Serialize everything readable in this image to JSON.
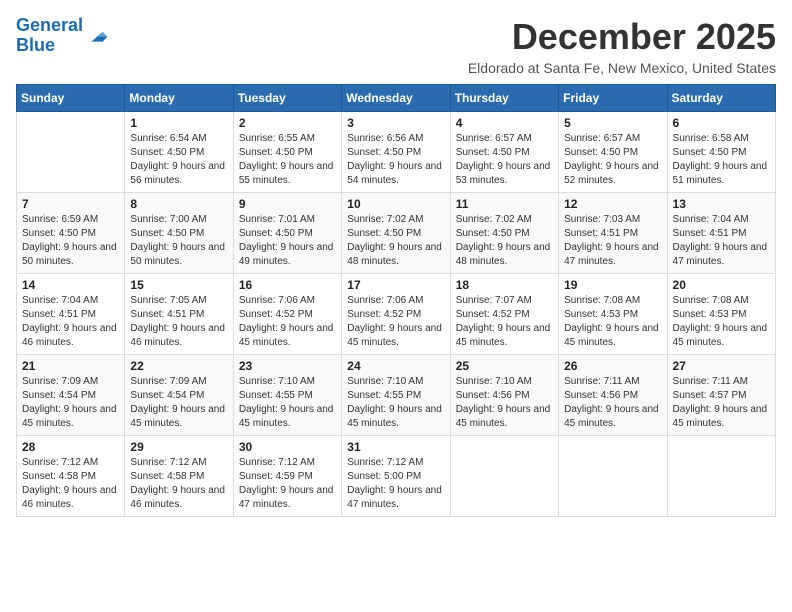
{
  "logo": {
    "text_general": "General",
    "text_blue": "Blue"
  },
  "title": "December 2025",
  "location": "Eldorado at Santa Fe, New Mexico, United States",
  "days_of_week": [
    "Sunday",
    "Monday",
    "Tuesday",
    "Wednesday",
    "Thursday",
    "Friday",
    "Saturday"
  ],
  "weeks": [
    [
      {
        "day": "",
        "sunrise": "",
        "sunset": "",
        "daylight": ""
      },
      {
        "day": "1",
        "sunrise": "Sunrise: 6:54 AM",
        "sunset": "Sunset: 4:50 PM",
        "daylight": "Daylight: 9 hours and 56 minutes."
      },
      {
        "day": "2",
        "sunrise": "Sunrise: 6:55 AM",
        "sunset": "Sunset: 4:50 PM",
        "daylight": "Daylight: 9 hours and 55 minutes."
      },
      {
        "day": "3",
        "sunrise": "Sunrise: 6:56 AM",
        "sunset": "Sunset: 4:50 PM",
        "daylight": "Daylight: 9 hours and 54 minutes."
      },
      {
        "day": "4",
        "sunrise": "Sunrise: 6:57 AM",
        "sunset": "Sunset: 4:50 PM",
        "daylight": "Daylight: 9 hours and 53 minutes."
      },
      {
        "day": "5",
        "sunrise": "Sunrise: 6:57 AM",
        "sunset": "Sunset: 4:50 PM",
        "daylight": "Daylight: 9 hours and 52 minutes."
      },
      {
        "day": "6",
        "sunrise": "Sunrise: 6:58 AM",
        "sunset": "Sunset: 4:50 PM",
        "daylight": "Daylight: 9 hours and 51 minutes."
      }
    ],
    [
      {
        "day": "7",
        "sunrise": "Sunrise: 6:59 AM",
        "sunset": "Sunset: 4:50 PM",
        "daylight": "Daylight: 9 hours and 50 minutes."
      },
      {
        "day": "8",
        "sunrise": "Sunrise: 7:00 AM",
        "sunset": "Sunset: 4:50 PM",
        "daylight": "Daylight: 9 hours and 50 minutes."
      },
      {
        "day": "9",
        "sunrise": "Sunrise: 7:01 AM",
        "sunset": "Sunset: 4:50 PM",
        "daylight": "Daylight: 9 hours and 49 minutes."
      },
      {
        "day": "10",
        "sunrise": "Sunrise: 7:02 AM",
        "sunset": "Sunset: 4:50 PM",
        "daylight": "Daylight: 9 hours and 48 minutes."
      },
      {
        "day": "11",
        "sunrise": "Sunrise: 7:02 AM",
        "sunset": "Sunset: 4:50 PM",
        "daylight": "Daylight: 9 hours and 48 minutes."
      },
      {
        "day": "12",
        "sunrise": "Sunrise: 7:03 AM",
        "sunset": "Sunset: 4:51 PM",
        "daylight": "Daylight: 9 hours and 47 minutes."
      },
      {
        "day": "13",
        "sunrise": "Sunrise: 7:04 AM",
        "sunset": "Sunset: 4:51 PM",
        "daylight": "Daylight: 9 hours and 47 minutes."
      }
    ],
    [
      {
        "day": "14",
        "sunrise": "Sunrise: 7:04 AM",
        "sunset": "Sunset: 4:51 PM",
        "daylight": "Daylight: 9 hours and 46 minutes."
      },
      {
        "day": "15",
        "sunrise": "Sunrise: 7:05 AM",
        "sunset": "Sunset: 4:51 PM",
        "daylight": "Daylight: 9 hours and 46 minutes."
      },
      {
        "day": "16",
        "sunrise": "Sunrise: 7:06 AM",
        "sunset": "Sunset: 4:52 PM",
        "daylight": "Daylight: 9 hours and 45 minutes."
      },
      {
        "day": "17",
        "sunrise": "Sunrise: 7:06 AM",
        "sunset": "Sunset: 4:52 PM",
        "daylight": "Daylight: 9 hours and 45 minutes."
      },
      {
        "day": "18",
        "sunrise": "Sunrise: 7:07 AM",
        "sunset": "Sunset: 4:52 PM",
        "daylight": "Daylight: 9 hours and 45 minutes."
      },
      {
        "day": "19",
        "sunrise": "Sunrise: 7:08 AM",
        "sunset": "Sunset: 4:53 PM",
        "daylight": "Daylight: 9 hours and 45 minutes."
      },
      {
        "day": "20",
        "sunrise": "Sunrise: 7:08 AM",
        "sunset": "Sunset: 4:53 PM",
        "daylight": "Daylight: 9 hours and 45 minutes."
      }
    ],
    [
      {
        "day": "21",
        "sunrise": "Sunrise: 7:09 AM",
        "sunset": "Sunset: 4:54 PM",
        "daylight": "Daylight: 9 hours and 45 minutes."
      },
      {
        "day": "22",
        "sunrise": "Sunrise: 7:09 AM",
        "sunset": "Sunset: 4:54 PM",
        "daylight": "Daylight: 9 hours and 45 minutes."
      },
      {
        "day": "23",
        "sunrise": "Sunrise: 7:10 AM",
        "sunset": "Sunset: 4:55 PM",
        "daylight": "Daylight: 9 hours and 45 minutes."
      },
      {
        "day": "24",
        "sunrise": "Sunrise: 7:10 AM",
        "sunset": "Sunset: 4:55 PM",
        "daylight": "Daylight: 9 hours and 45 minutes."
      },
      {
        "day": "25",
        "sunrise": "Sunrise: 7:10 AM",
        "sunset": "Sunset: 4:56 PM",
        "daylight": "Daylight: 9 hours and 45 minutes."
      },
      {
        "day": "26",
        "sunrise": "Sunrise: 7:11 AM",
        "sunset": "Sunset: 4:56 PM",
        "daylight": "Daylight: 9 hours and 45 minutes."
      },
      {
        "day": "27",
        "sunrise": "Sunrise: 7:11 AM",
        "sunset": "Sunset: 4:57 PM",
        "daylight": "Daylight: 9 hours and 45 minutes."
      }
    ],
    [
      {
        "day": "28",
        "sunrise": "Sunrise: 7:12 AM",
        "sunset": "Sunset: 4:58 PM",
        "daylight": "Daylight: 9 hours and 46 minutes."
      },
      {
        "day": "29",
        "sunrise": "Sunrise: 7:12 AM",
        "sunset": "Sunset: 4:58 PM",
        "daylight": "Daylight: 9 hours and 46 minutes."
      },
      {
        "day": "30",
        "sunrise": "Sunrise: 7:12 AM",
        "sunset": "Sunset: 4:59 PM",
        "daylight": "Daylight: 9 hours and 47 minutes."
      },
      {
        "day": "31",
        "sunrise": "Sunrise: 7:12 AM",
        "sunset": "Sunset: 5:00 PM",
        "daylight": "Daylight: 9 hours and 47 minutes."
      },
      {
        "day": "",
        "sunrise": "",
        "sunset": "",
        "daylight": ""
      },
      {
        "day": "",
        "sunrise": "",
        "sunset": "",
        "daylight": ""
      },
      {
        "day": "",
        "sunrise": "",
        "sunset": "",
        "daylight": ""
      }
    ]
  ]
}
